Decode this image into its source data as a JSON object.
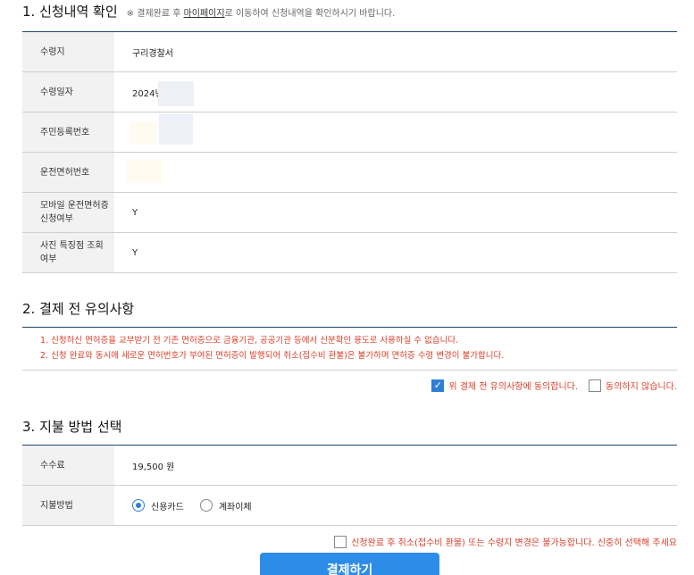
{
  "section1": {
    "title": "1. 신청내역 확인",
    "note_prefix": "※ 결제완료 후 ",
    "note_link": "마이페이지",
    "note_suffix": "로 이동하여 신청내역을 확인하시기 바랍니다.",
    "rows": [
      {
        "label": "수령지",
        "value": "구리경찰서"
      },
      {
        "label": "수령일자",
        "value": "2024년"
      },
      {
        "label": "주민등록번호",
        "value": ""
      },
      {
        "label": "운전면허번호",
        "value": ""
      },
      {
        "label": "모바일 운전면허증 신청여부",
        "value": "Y"
      },
      {
        "label": "사진 특징점 조회 여부",
        "value": "Y"
      }
    ]
  },
  "section2": {
    "title": "2. 결제 전 유의사항",
    "notices": [
      "1. 신청하신 면허증을 교부받기 전 기존 면허증으로 금융기관, 공공기관 등에서 신분확인 용도로 사용하실 수 없습니다.",
      "2. 신청 완료와 동시에 새로운 면허번호가 부여된 면허증이 발행되어 취소(접수비 환불)은 불가하며 면허증 수령 변경이 불가합니다."
    ],
    "agree_label": "위 결제 전 유의사항에 동의합니다.",
    "disagree_label": "동의하지 않습니다.",
    "agree_checked": true,
    "disagree_checked": false
  },
  "section3": {
    "title": "3. 지불 방법 선택",
    "fee_label": "수수료",
    "fee_value": "19,500 원",
    "method_label": "지불방법",
    "methods": [
      "신용카드",
      "계좌이체"
    ],
    "selected_method": "신용카드"
  },
  "final_confirm": {
    "label": "신청완료 후 취소(접수비 환불) 또는 수령지 변경은 불가능합니다. 신중히 선택해 주세요",
    "checked": false
  },
  "pay_button": "결제하기",
  "colors": {
    "accent": "#2d8ce8",
    "warning": "#d9402b",
    "rule": "#22466b"
  },
  "icons": {
    "check": "check-icon",
    "radio": "radio-icon"
  }
}
